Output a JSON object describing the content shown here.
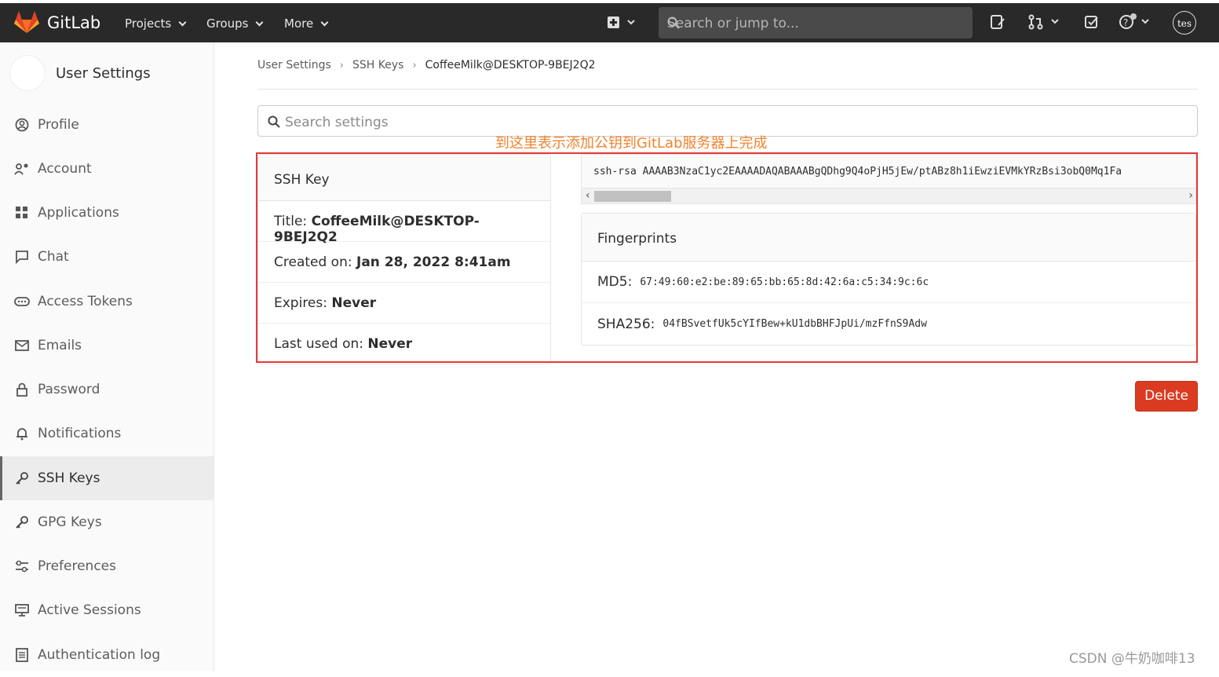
{
  "topbar": {
    "brand": "GitLab",
    "nav": [
      "Projects",
      "Groups",
      "More"
    ],
    "search_placeholder": "Search or jump to...",
    "avatar_text": "tes"
  },
  "sidebar": {
    "title": "User Settings",
    "items": [
      {
        "label": "Profile",
        "icon": "profile-icon"
      },
      {
        "label": "Account",
        "icon": "account-icon"
      },
      {
        "label": "Applications",
        "icon": "applications-icon"
      },
      {
        "label": "Chat",
        "icon": "chat-icon"
      },
      {
        "label": "Access Tokens",
        "icon": "token-icon"
      },
      {
        "label": "Emails",
        "icon": "email-icon"
      },
      {
        "label": "Password",
        "icon": "lock-icon"
      },
      {
        "label": "Notifications",
        "icon": "bell-icon"
      },
      {
        "label": "SSH Keys",
        "icon": "key-icon",
        "active": true
      },
      {
        "label": "GPG Keys",
        "icon": "key-icon"
      },
      {
        "label": "Preferences",
        "icon": "preferences-icon"
      },
      {
        "label": "Active Sessions",
        "icon": "monitor-icon"
      },
      {
        "label": "Authentication log",
        "icon": "log-icon"
      }
    ]
  },
  "breadcrumb": [
    "User Settings",
    "SSH Keys",
    "CoffeeMilk@DESKTOP-9BEJ2Q2"
  ],
  "settings_search_placeholder": "Search settings",
  "annotation": "到这里表示添加公钥到GitLab服务器上完成",
  "ssh_key": {
    "header": "SSH Key",
    "title_label": "Title:",
    "title_value": "CoffeeMilk@DESKTOP-9BEJ2Q2",
    "created_label": "Created on:",
    "created_value": "Jan 28, 2022 8:41am",
    "expires_label": "Expires:",
    "expires_value": "Never",
    "last_used_label": "Last used on:",
    "last_used_value": "Never",
    "key_text": "ssh-rsa AAAAB3NzaC1yc2EAAAADAQABAAABgQDhg9Q4oPjH5jEw/ptABz8h1iEwziEVMkYRzBsi3obQ0Mq1Fa"
  },
  "fingerprints": {
    "header": "Fingerprints",
    "md5_label": "MD5:",
    "md5_value": "67:49:60:e2:be:89:65:bb:65:8d:42:6a:c5:34:9c:6c",
    "sha256_label": "SHA256:",
    "sha256_value": "04fBSvetfUk5cYIfBew+kU1dbBHFJpUi/mzFfnS9Adw"
  },
  "delete_label": "Delete",
  "watermark": "CSDN @牛奶咖啡13",
  "colors": {
    "topbar": "#292929",
    "delete": "#db3b21",
    "annotation": "#f0832d",
    "highlight": "#e53935"
  }
}
